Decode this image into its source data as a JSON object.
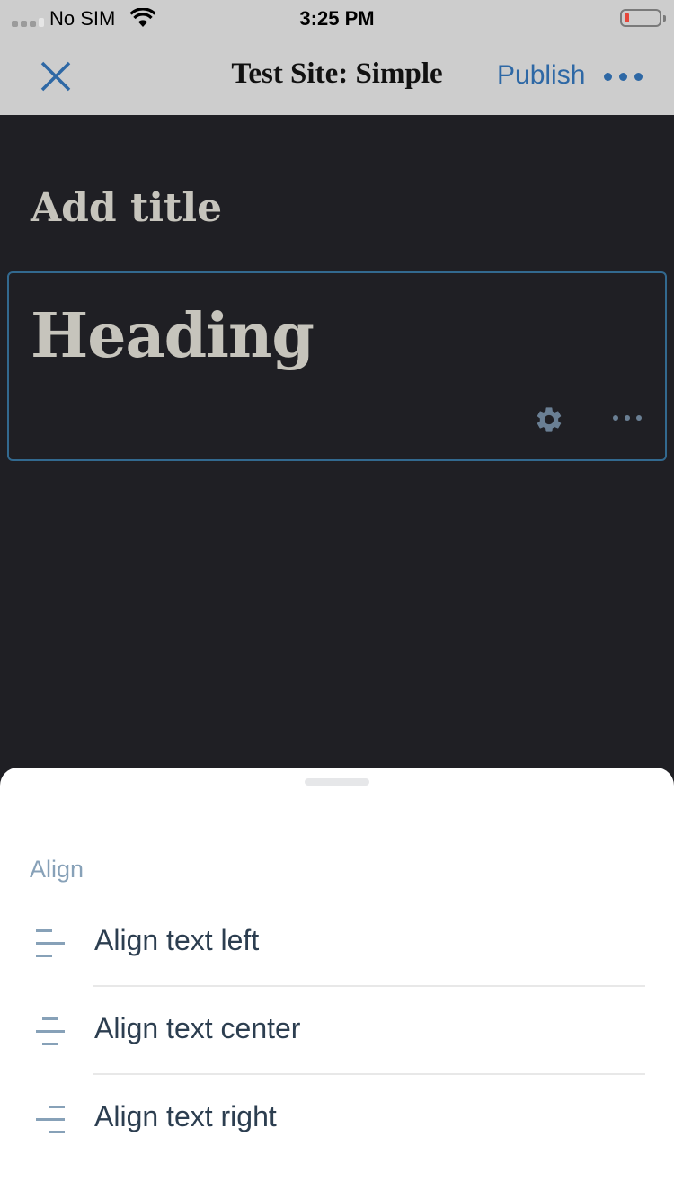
{
  "status_bar": {
    "carrier": "No SIM",
    "time": "3:25 PM",
    "battery_level_percent": 10,
    "battery_color": "#e5463a",
    "icons": [
      "signal-icon",
      "wifi-icon",
      "battery-icon"
    ]
  },
  "nav": {
    "close_icon": "close-icon",
    "title": "Test Site: Simple",
    "publish_label": "Publish",
    "more_icon": "more-horizontal-icon",
    "accent_color": "#2e68a5"
  },
  "editor": {
    "title_placeholder": "Add title",
    "heading_block": {
      "text": "Heading",
      "settings_icon": "gear-icon",
      "more_icon": "more-horizontal-icon",
      "selected_border_color": "#32698f"
    }
  },
  "sheet": {
    "section_label": "Align",
    "options": [
      {
        "label": "Align text left",
        "icon": "align-left-icon"
      },
      {
        "label": "Align text center",
        "icon": "align-center-icon"
      },
      {
        "label": "Align text right",
        "icon": "align-right-icon"
      }
    ]
  }
}
